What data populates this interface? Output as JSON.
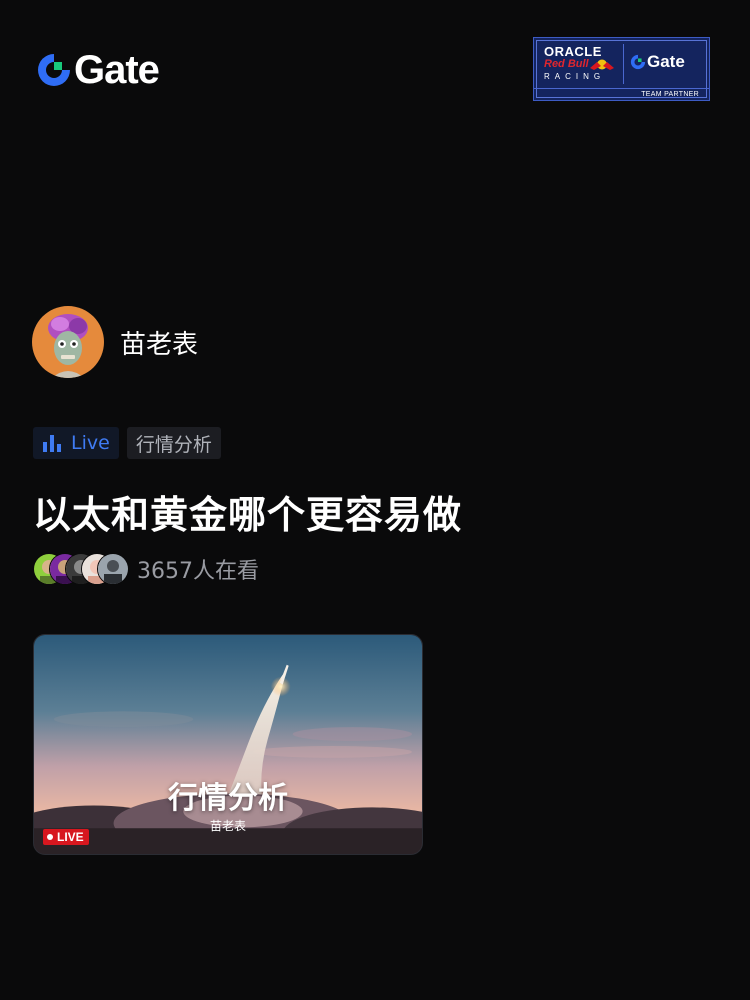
{
  "header": {
    "brand": "Gate",
    "partner": {
      "line1": "ORACLE",
      "line2": "Red Bull",
      "line3": "RACING",
      "brand": "Gate",
      "footer": "TEAM PARTNER"
    }
  },
  "host": {
    "name": "苗老表"
  },
  "tags": [
    {
      "label": "Live",
      "icon": "bar-chart-icon"
    },
    {
      "label": "行情分析"
    }
  ],
  "stream": {
    "title": "以太和黄金哪个更容易做",
    "viewer_count": "3657人在看"
  },
  "card": {
    "title": "行情分析",
    "host": "苗老表",
    "badge": "LIVE"
  },
  "colors": {
    "background": "#0a0a0b",
    "accent": "#3f7bf3",
    "live_red": "#d7171f",
    "gate_green": "#18c97c"
  }
}
